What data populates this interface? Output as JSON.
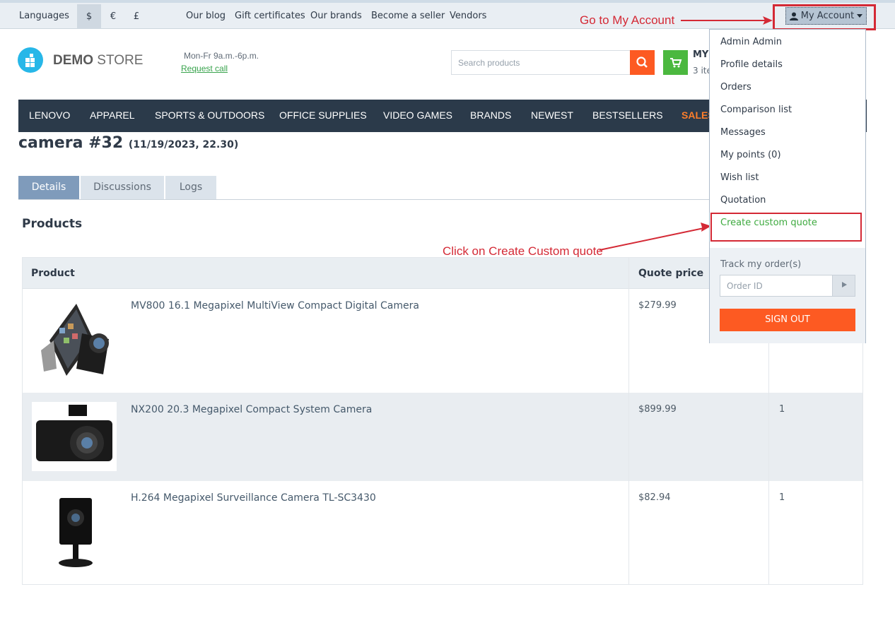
{
  "topbar": {
    "languages": "Languages",
    "currencies": [
      "$",
      "€",
      "£"
    ],
    "links": [
      "Our blog",
      "Gift certificates",
      "Our brands",
      "Become a seller",
      "Vendors"
    ],
    "account_label": "My Account"
  },
  "annotations": {
    "go_account": "Go to My Account",
    "click_quote": "Click on Create Custom quote"
  },
  "header": {
    "logo_bold": "DEMO",
    "logo_light": "STORE",
    "hours": "Mon-Fr 9a.m.-6p.m.",
    "request_call": "Request call",
    "search_placeholder": "Search products",
    "cart_title": "MY",
    "cart_items": "3 ite"
  },
  "nav": [
    "LENOVO",
    "APPAREL",
    "SPORTS & OUTDOORS",
    "OFFICE SUPPLIES",
    "VIDEO GAMES",
    "BRANDS",
    "NEWEST",
    "BESTSELLERS",
    "SALES"
  ],
  "page": {
    "title": "camera #32",
    "subtitle": "(11/19/2023, 22.30)",
    "tabs": [
      "Details",
      "Discussions",
      "Logs"
    ],
    "section": "Products"
  },
  "table": {
    "headers": [
      "Product",
      "Quote price"
    ],
    "rows": [
      {
        "name": "MV800 16.1 Megapixel MultiView Compact Digital Camera",
        "price": "$279.99",
        "qty": ""
      },
      {
        "name": "NX200 20.3 Megapixel Compact System Camera",
        "price": "$899.99",
        "qty": "1"
      },
      {
        "name": "H.264 Megapixel Surveillance Camera TL-SC3430",
        "price": "$82.94",
        "qty": "1"
      }
    ]
  },
  "dropdown": {
    "items": [
      "Admin Admin",
      "Profile details",
      "Orders",
      "Comparison list",
      "Messages",
      "My points (0)",
      "Wish list",
      "Quotation",
      "Create custom quote"
    ],
    "track_label": "Track my order(s)",
    "order_placeholder": "Order ID",
    "sign_out": "SIGN OUT"
  },
  "colors": {
    "accent_orange": "#fd5a22",
    "nav_bg": "#2b3a4a",
    "annotation_red": "#d42935",
    "link_green": "#3eaa3f"
  }
}
